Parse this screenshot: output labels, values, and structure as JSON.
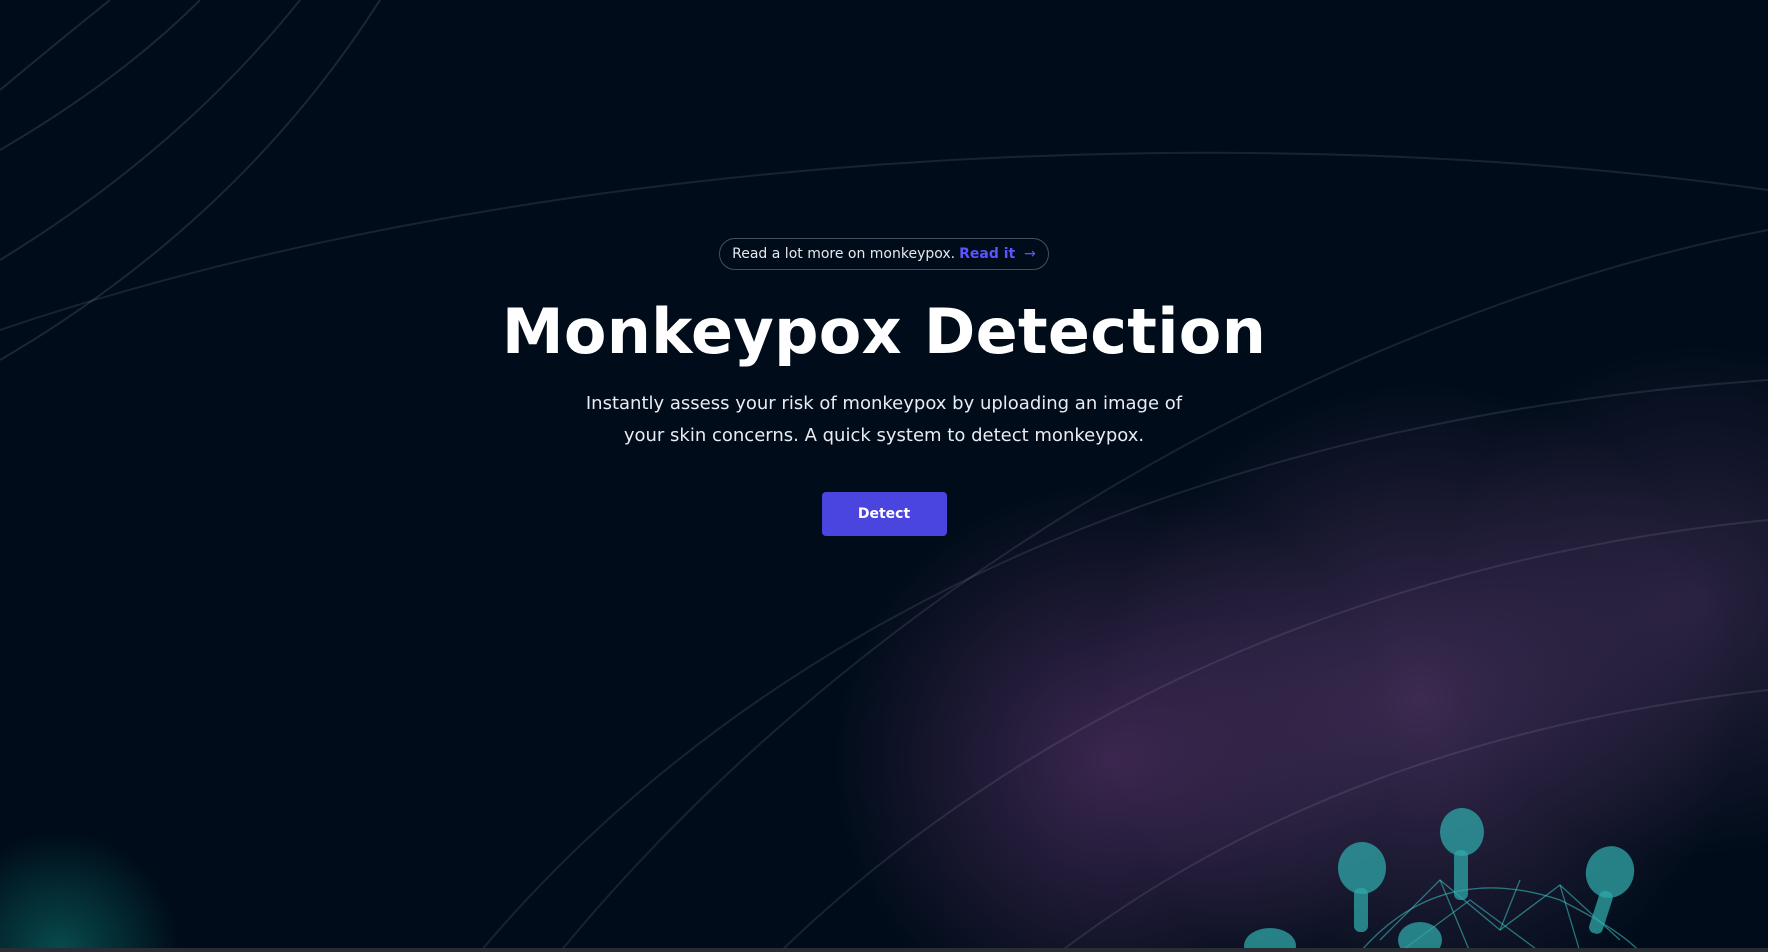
{
  "hero": {
    "announcement_text": "Read a lot more on monkeypox.",
    "announcement_link": "Read it",
    "announcement_arrow": "→",
    "title": "Monkeypox Detection",
    "subtitle": "Instantly assess your risk of monkeypox by uploading an image of your skin concerns. A quick system to detect monkeypox.",
    "detect_button": "Detect"
  },
  "colors": {
    "background": "#000c19",
    "accent": "#4b45e0",
    "link": "#5b55ff",
    "text": "#ffffff",
    "virus": "#2fa7a8"
  },
  "icons": {
    "arrow": "arrow-right-icon",
    "virus": "virus-illustration"
  }
}
